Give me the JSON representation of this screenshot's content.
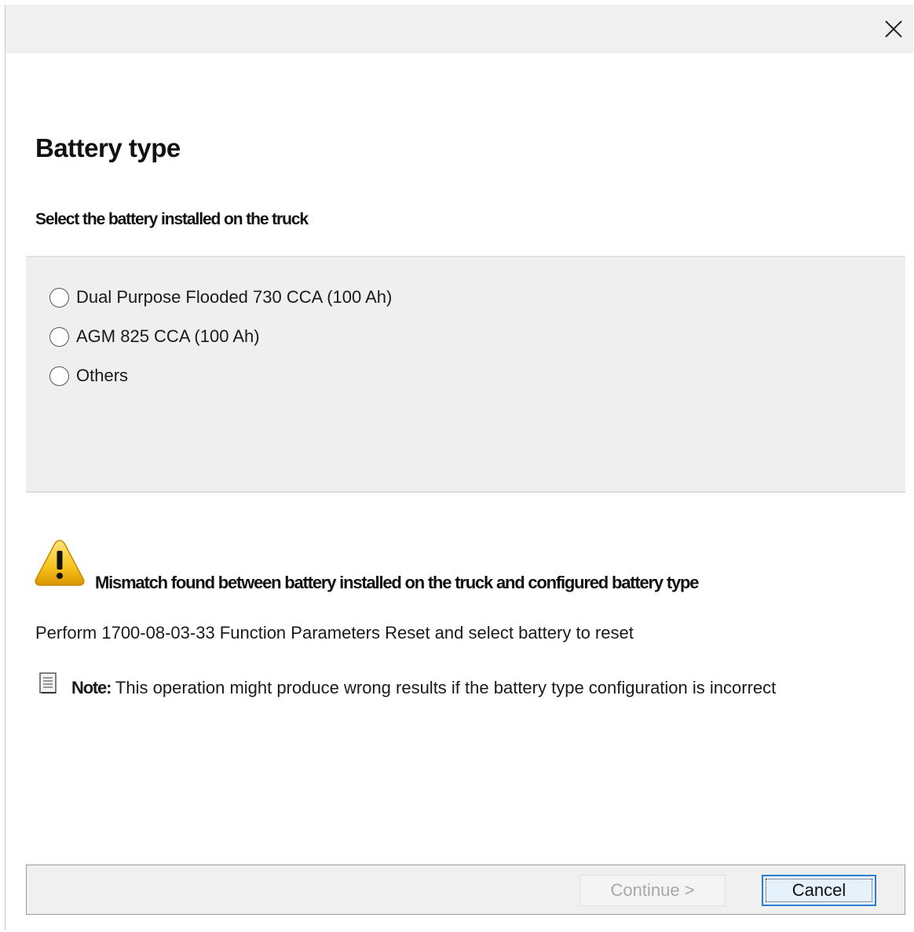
{
  "window": {
    "close_icon": "close-icon"
  },
  "header": {
    "title": "Battery type",
    "subtitle": "Select the battery installed on the truck"
  },
  "battery_options": [
    {
      "label": "Dual Purpose Flooded 730 CCA (100 Ah)",
      "selected": false
    },
    {
      "label": "AGM 825 CCA (100 Ah)",
      "selected": false
    },
    {
      "label": "Others",
      "selected": false
    }
  ],
  "warning": {
    "icon": "warning-icon",
    "text": "Mismatch found between battery installed on the truck and configured battery type",
    "accent_color": "#f5b800"
  },
  "instruction": "Perform 1700-08-03-33 Function Parameters Reset and select battery to reset",
  "note": {
    "icon": "note-icon",
    "label": "Note:",
    "text": " This operation might produce wrong results if the battery type configuration is incorrect"
  },
  "footer": {
    "continue_label": "Continue >",
    "continue_enabled": false,
    "cancel_label": "Cancel",
    "focus_color": "#2f7fd1"
  }
}
